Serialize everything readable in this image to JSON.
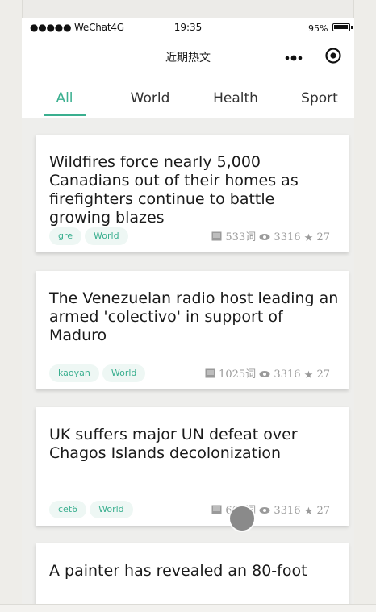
{
  "status": {
    "carrier": "●●●●● WeChat4G",
    "time": "19:35",
    "battery": "95%"
  },
  "nav": {
    "title": "近期热文"
  },
  "tabs": [
    "All",
    "World",
    "Health",
    "Sport"
  ],
  "active_tab": "All",
  "accent_color": "#3aaf8f",
  "articles": [
    {
      "title": "Wildfires force nearly 5,000 Canadians out of their homes as firefighters continue to battle growing blazes",
      "tags": [
        "gre",
        "World"
      ],
      "words": "533词",
      "views": "3316",
      "stars": "27"
    },
    {
      "title": "The Venezuelan radio host leading an armed 'colectivo' in support of Maduro",
      "tags": [
        "kaoyan",
        "World"
      ],
      "words": "1025词",
      "views": "3316",
      "stars": "27"
    },
    {
      "title": "UK suffers major UN defeat over Chagos Islands decolonization",
      "tags": [
        "cet6",
        "World"
      ],
      "words": "603词",
      "views": "3316",
      "stars": "27"
    },
    {
      "title": "A painter has revealed an 80-foot"
    }
  ]
}
